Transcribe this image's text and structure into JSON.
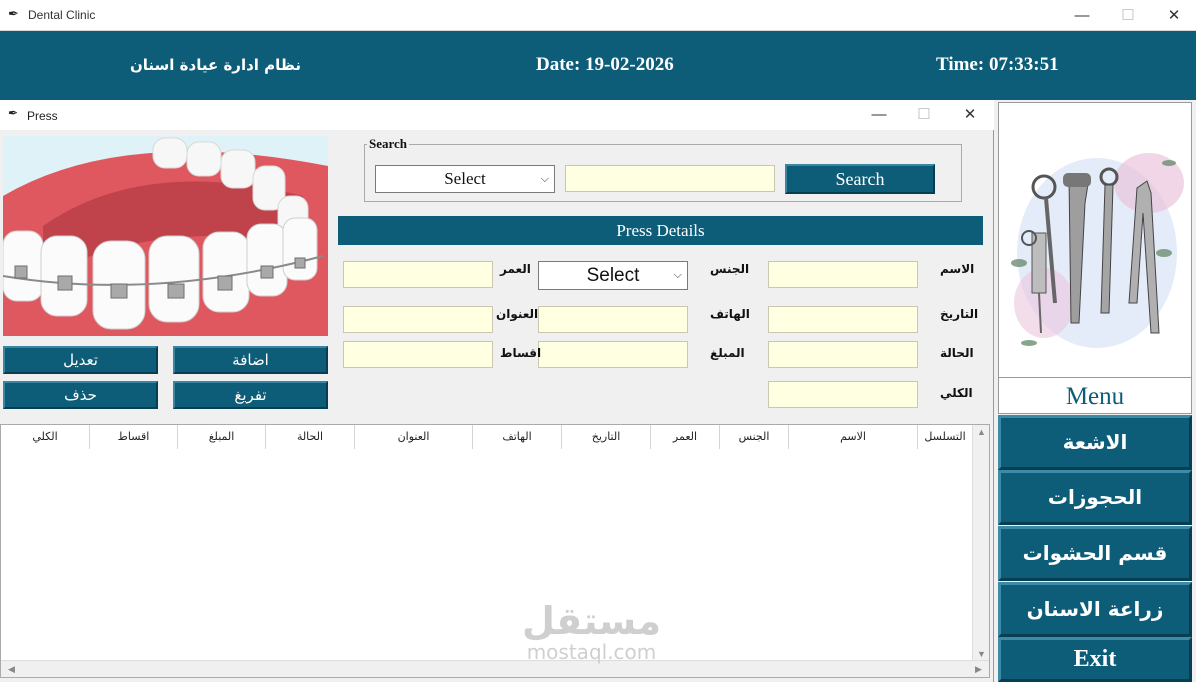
{
  "window": {
    "title": "Dental Clinic"
  },
  "header": {
    "system_name": "نظام ادارة عيادة اسنان",
    "date": "Date: 19-02-2026",
    "time": "Time: 07:33:51"
  },
  "inner_window": {
    "title": "Press"
  },
  "search": {
    "group_label": "Search",
    "select_value": "Select",
    "input_value": "",
    "button_label": "Search"
  },
  "details": {
    "title": "Press Details",
    "labels": {
      "name": "الاسم",
      "gender": "الجنس",
      "age": "العمر",
      "date": "التاريخ",
      "phone": "الهاتف",
      "address": "العنوان",
      "status": "الحالة",
      "amount": "المبلغ",
      "installments": "اقساط",
      "total": "الكلي"
    },
    "gender_select": "Select",
    "values": {
      "name": "",
      "age": "",
      "date": "",
      "phone": "",
      "address": "",
      "status": "",
      "amount": "",
      "installments": "",
      "total": ""
    }
  },
  "actions": {
    "add": "اضافة",
    "edit": "تعديل",
    "clear": "تفريغ",
    "delete": "حذف"
  },
  "table": {
    "columns": [
      "التسلسل",
      "الاسم",
      "الجنس",
      "العمر",
      "التاريخ",
      "الهاتف",
      "العنوان",
      "الحالة",
      "المبلغ",
      "اقساط",
      "الكلي"
    ],
    "rows": []
  },
  "watermark": {
    "arabic": "مستقل",
    "latin": "mostaql.com"
  },
  "menu": {
    "title": "Menu",
    "items": [
      "الاشعة",
      "الحجوزات",
      "قسم الحشوات",
      "زراعة الاسنان",
      "Exit"
    ]
  },
  "colors": {
    "brand": "#0d5d79",
    "field": "#ffffe1",
    "gum": "#e45c63"
  },
  "icons": {
    "window": "feather-icon",
    "chevron": "chevron-down-icon"
  }
}
